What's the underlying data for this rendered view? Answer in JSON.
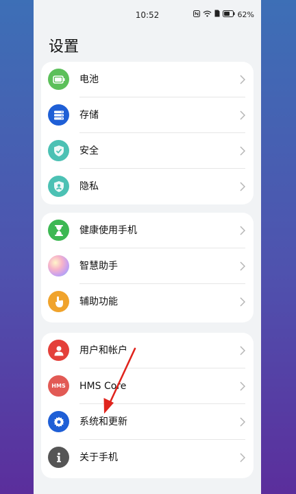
{
  "status": {
    "time": "10:52",
    "battery": "62%"
  },
  "title": "设置",
  "groups": [
    {
      "items": [
        {
          "label": "电池",
          "icon": "battery-icon",
          "color": "#5cc05a"
        },
        {
          "label": "存储",
          "icon": "storage-icon",
          "color": "#1f5fd6"
        },
        {
          "label": "安全",
          "icon": "shield-check-icon",
          "color": "#4cc1b4"
        },
        {
          "label": "隐私",
          "icon": "privacy-icon",
          "color": "#4cc1b4"
        }
      ]
    },
    {
      "items": [
        {
          "label": "健康使用手机",
          "icon": "hourglass-icon",
          "color": "#3db853"
        },
        {
          "label": "智慧助手",
          "icon": "assistant-icon",
          "color": "#e6a9d9"
        },
        {
          "label": "辅助功能",
          "icon": "hand-icon",
          "color": "#f0a32c"
        }
      ]
    },
    {
      "items": [
        {
          "label": "用户和帐户",
          "icon": "user-icon",
          "color": "#e4403a"
        },
        {
          "label": "HMS Core",
          "icon": "hms-icon",
          "color": "#e25a55",
          "badge": "HMS"
        },
        {
          "label": "系统和更新",
          "icon": "system-update-icon",
          "color": "#1f5fd6"
        },
        {
          "label": "关于手机",
          "icon": "info-icon",
          "color": "#555555"
        }
      ]
    }
  ]
}
